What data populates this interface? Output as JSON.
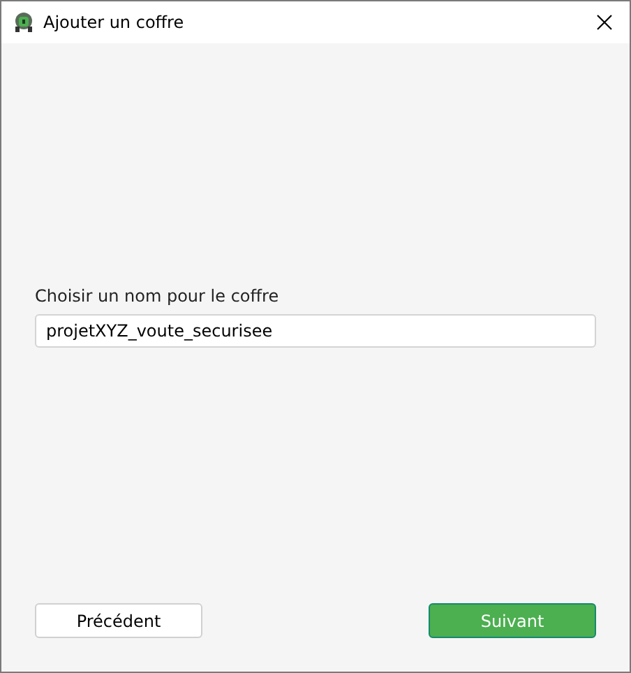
{
  "window": {
    "title": "Ajouter un coffre"
  },
  "form": {
    "label": "Choisir un nom pour le coffre",
    "value": "projetXYZ_voute_securisee"
  },
  "buttons": [
    {
      "kind": "secondary",
      "label": "Précédent"
    },
    {
      "kind": "primary",
      "label": "Suivant"
    }
  ]
}
